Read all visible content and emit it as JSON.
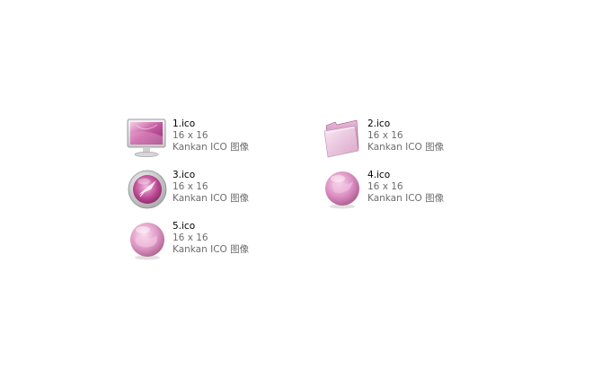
{
  "files": [
    {
      "name": "1.ico",
      "dimensions": "16 x 16",
      "type": "Kankan ICO 图像",
      "icon": "monitor-icon"
    },
    {
      "name": "2.ico",
      "dimensions": "16 x 16",
      "type": "Kankan ICO 图像",
      "icon": "folder-icon"
    },
    {
      "name": "3.ico",
      "dimensions": "16 x 16",
      "type": "Kankan ICO 图像",
      "icon": "compass-icon"
    },
    {
      "name": "4.ico",
      "dimensions": "16 x 16",
      "type": "Kankan ICO 图像",
      "icon": "globe-icon"
    },
    {
      "name": "5.ico",
      "dimensions": "16 x 16",
      "type": "Kankan ICO 图像",
      "icon": "globe-icon"
    }
  ],
  "colors": {
    "background": "#ffffff",
    "name_text": "#000000",
    "meta_text": "#6d6d6d",
    "icon_pink": "#d98cc0"
  }
}
